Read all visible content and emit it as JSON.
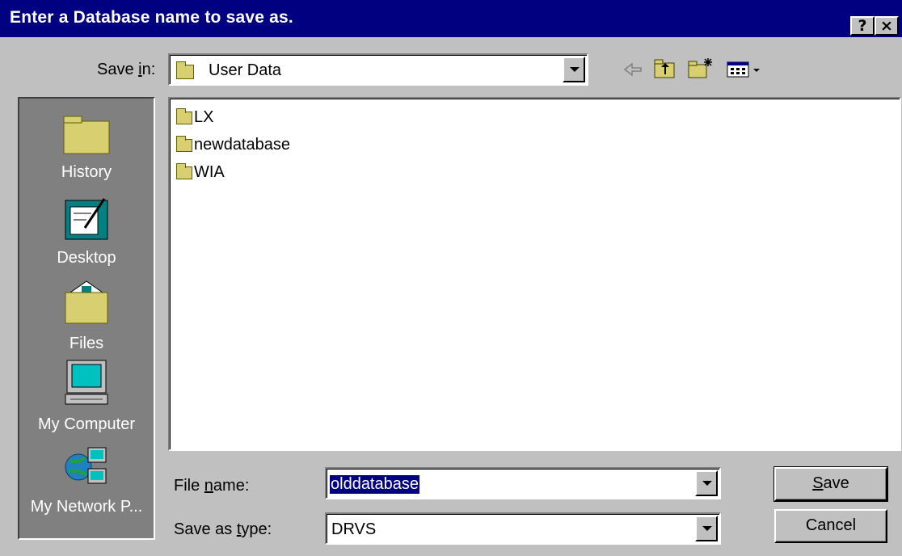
{
  "window": {
    "title": "Enter a Database name to save as.",
    "help_label": "?",
    "close_label": "×"
  },
  "toolbar": {
    "save_in_label_pre": "Save ",
    "save_in_label_key": "i",
    "save_in_label_post": "n:",
    "location_value": "User Data",
    "icons": [
      "back-arrow-icon",
      "up-one-level-icon",
      "new-folder-icon",
      "view-menu-icon"
    ]
  },
  "places": [
    {
      "label": "History",
      "icon": "history-folder-icon"
    },
    {
      "label": "Desktop",
      "icon": "desktop-icon"
    },
    {
      "label": "Files",
      "icon": "files-folder-icon"
    },
    {
      "label": "My Computer",
      "icon": "my-computer-icon"
    },
    {
      "label": "My Network P...",
      "icon": "network-places-icon"
    }
  ],
  "files": [
    {
      "name": "LX"
    },
    {
      "name": "newdatabase"
    },
    {
      "name": "WIA"
    }
  ],
  "form": {
    "file_name_label_pre": "File ",
    "file_name_label_key": "n",
    "file_name_label_post": "ame:",
    "file_name_value": "olddatabase",
    "save_type_label_pre": "Save as ",
    "save_type_label_key": "t",
    "save_type_label_post": "ype:",
    "save_type_value": "DRVS"
  },
  "buttons": {
    "save_key": "S",
    "save_rest": "ave",
    "cancel_label": "Cancel"
  }
}
